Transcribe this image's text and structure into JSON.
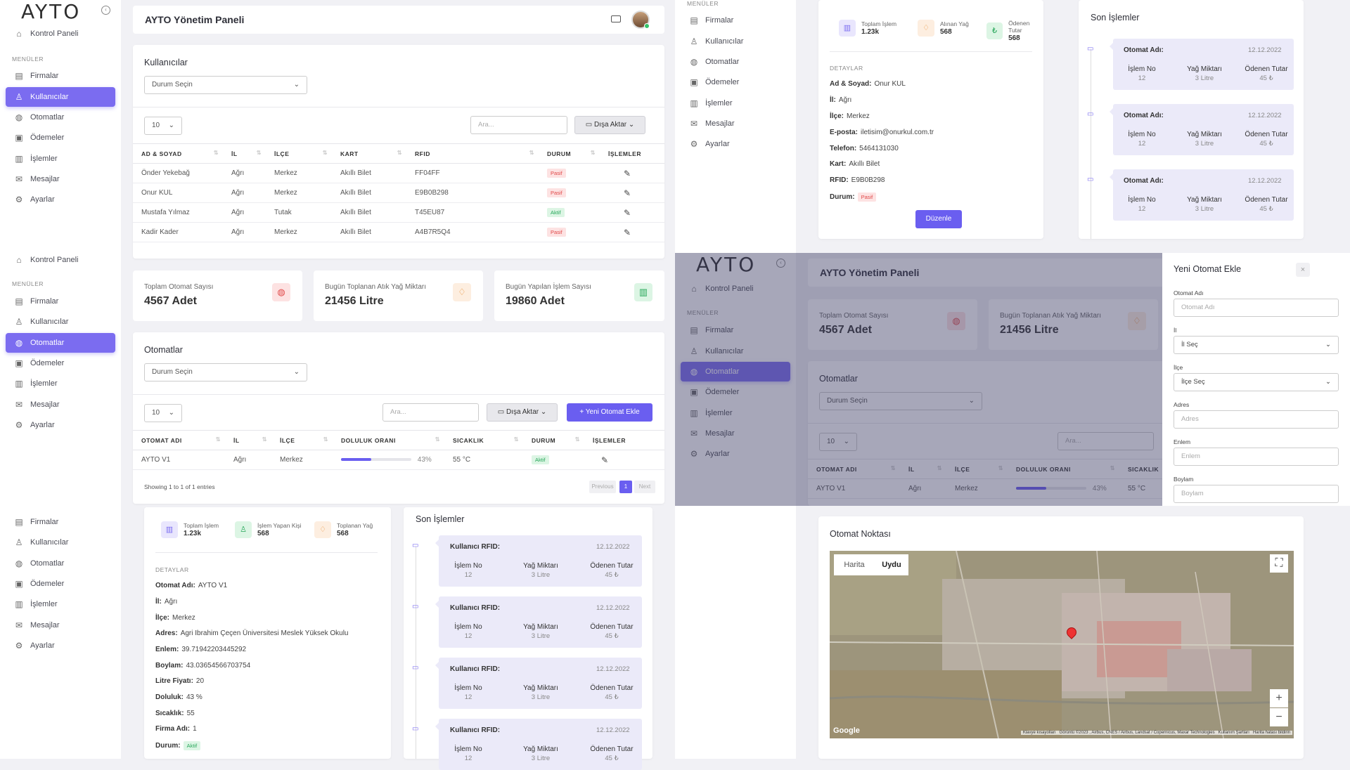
{
  "brand": {
    "logo": "AYTO",
    "app_title": "AYTO Yönetim Paneli"
  },
  "sidebar": {
    "dashboard": "Kontrol Paneli",
    "section": "MENÜLER",
    "items": [
      "Firmalar",
      "Kullanıcılar",
      "Otomatlar",
      "Ödemeler",
      "İşlemler",
      "Mesajlar",
      "Ayarlar"
    ]
  },
  "users": {
    "title": "Kullanıcılar",
    "status_filter": "Durum Seçin",
    "page_size": "10",
    "search_placeholder": "Ara...",
    "export": "Dışa Aktar",
    "columns": [
      "AD & SOYAD",
      "İL",
      "İLÇE",
      "KART",
      "RFID",
      "DURUM",
      "İŞLEMLER"
    ],
    "rows": [
      {
        "name": "Önder Yekebağ",
        "il": "Ağrı",
        "ilce": "Merkez",
        "kart": "Akıllı Bilet",
        "rfid": "FF04FF",
        "durum": "Pasif"
      },
      {
        "name": "Onur KUL",
        "il": "Ağrı",
        "ilce": "Merkez",
        "kart": "Akıllı Bilet",
        "rfid": "E9B0B298",
        "durum": "Pasif"
      },
      {
        "name": "Mustafa Yılmaz",
        "il": "Ağrı",
        "ilce": "Tutak",
        "kart": "Akıllı Bilet",
        "rfid": "T45EU87",
        "durum": "Aktif"
      },
      {
        "name": "Kadir Kader",
        "il": "Ağrı",
        "ilce": "Merkez",
        "kart": "Akıllı Bilet",
        "rfid": "A4B7R5Q4",
        "durum": "Pasif"
      }
    ]
  },
  "stats": [
    {
      "label": "Toplam Otomat Sayısı",
      "value": "4567 Adet"
    },
    {
      "label": "Bugün Toplanan Atık Yağ Miktarı",
      "value": "21456 Litre"
    },
    {
      "label": "Bugün Yapılan İşlem Sayısı",
      "value": "19860 Adet"
    }
  ],
  "machines": {
    "title": "Otomatlar",
    "status_filter": "Durum Seçin",
    "page_size": "10",
    "search_placeholder": "Ara...",
    "export": "Dışa Aktar",
    "add": "Yeni Otomat Ekle",
    "columns": [
      "OTOMAT ADI",
      "İL",
      "İLÇE",
      "DOLULUK ORANI",
      "SICAKLIK",
      "DURUM",
      "İŞLEMLER"
    ],
    "rows": [
      {
        "name": "AYTO V1",
        "il": "Ağrı",
        "ilce": "Merkez",
        "doluluk": 43,
        "doluluk_text": "43%",
        "sicaklik": "55 °C",
        "durum": "Aktif"
      }
    ],
    "showing": "Showing 1 to 1 of 1 entries",
    "prev": "Previous",
    "page": "1",
    "next": "Next"
  },
  "machine_detail": {
    "mini": [
      {
        "label": "Toplam İşlem",
        "value": "1.23k"
      },
      {
        "label": "İşlem Yapan Kişi",
        "value": "568"
      },
      {
        "label": "Toplanan Yağ",
        "value": "568"
      }
    ],
    "heading": "DETAYLAR",
    "fields": [
      {
        "k": "Otomat Adı:",
        "v": "AYTO V1"
      },
      {
        "k": "İl:",
        "v": "Ağrı"
      },
      {
        "k": "İlçe:",
        "v": "Merkez"
      },
      {
        "k": "Adres:",
        "v": "Agri Ibrahim Çeçen Üniversitesi Meslek Yüksek Okulu"
      },
      {
        "k": "Enlem:",
        "v": "39.71942203445292"
      },
      {
        "k": "Boylam:",
        "v": "43.03654566703754"
      },
      {
        "k": "Litre Fiyatı:",
        "v": "20"
      },
      {
        "k": "Doluluk:",
        "v": "43 %"
      },
      {
        "k": "Sıcaklık:",
        "v": "55"
      },
      {
        "k": "Firma Adı:",
        "v": "1"
      },
      {
        "k": "Durum:",
        "v": "Aktif"
      }
    ]
  },
  "recent_machine": {
    "title": "Son İşlemler",
    "items": [
      {
        "title": "Kullanıcı RFID:",
        "date": "12.12.2022",
        "islem_label": "İşlem No",
        "islem": "12",
        "yag_label": "Yağ Miktarı",
        "yag": "3 Litre",
        "tutar_label": "Ödenen Tutar",
        "tutar": "45 ₺"
      },
      {
        "title": "Kullanıcı RFID:",
        "date": "12.12.2022",
        "islem_label": "İşlem No",
        "islem": "12",
        "yag_label": "Yağ Miktarı",
        "yag": "3 Litre",
        "tutar_label": "Ödenen Tutar",
        "tutar": "45 ₺"
      },
      {
        "title": "Kullanıcı RFID:",
        "date": "12.12.2022",
        "islem_label": "İşlem No",
        "islem": "12",
        "yag_label": "Yağ Miktarı",
        "yag": "3 Litre",
        "tutar_label": "Ödenen Tutar",
        "tutar": "45 ₺"
      },
      {
        "title": "Kullanıcı RFID:",
        "date": "12.12.2022",
        "islem_label": "İşlem No",
        "islem": "12",
        "yag_label": "Yağ Miktarı",
        "yag": "3 Litre",
        "tutar_label": "Ödenen Tutar",
        "tutar": "45 ₺"
      }
    ]
  },
  "user_detail": {
    "mini": [
      {
        "label": "Toplam İşlem",
        "value": "1.23k"
      },
      {
        "label": "Alınan Yağ",
        "value": "568"
      },
      {
        "label": "Ödenen Tutar",
        "value": "568"
      }
    ],
    "heading": "DETAYLAR",
    "fields": [
      {
        "k": "Ad & Soyad:",
        "v": "Onur KUL"
      },
      {
        "k": "İl:",
        "v": "Ağrı"
      },
      {
        "k": "İlçe:",
        "v": "Merkez"
      },
      {
        "k": "E-posta:",
        "v": "iletisim@onurkul.com.tr"
      },
      {
        "k": "Telefon:",
        "v": "5464131030"
      },
      {
        "k": "Kart:",
        "v": "Akıllı Bilet"
      },
      {
        "k": "RFID:",
        "v": "E9B0B298"
      },
      {
        "k": "Durum:",
        "v": "Pasif"
      }
    ],
    "edit": "Düzenle"
  },
  "recent_user": {
    "title": "Son İşlemler",
    "items": [
      {
        "title": "Otomat Adı:",
        "date": "12.12.2022",
        "islem_label": "İşlem No",
        "islem": "12",
        "yag_label": "Yağ Miktarı",
        "yag": "3 Litre",
        "tutar_label": "Ödenen Tutar",
        "tutar": "45 ₺"
      },
      {
        "title": "Otomat Adı:",
        "date": "12.12.2022",
        "islem_label": "İşlem No",
        "islem": "12",
        "yag_label": "Yağ Miktarı",
        "yag": "3 Litre",
        "tutar_label": "Ödenen Tutar",
        "tutar": "45 ₺"
      },
      {
        "title": "Otomat Adı:",
        "date": "12.12.2022",
        "islem_label": "İşlem No",
        "islem": "12",
        "yag_label": "Yağ Miktarı",
        "yag": "3 Litre",
        "tutar_label": "Ödenen Tutar",
        "tutar": "45 ₺"
      }
    ]
  },
  "modal": {
    "title": "Yeni Otomat Ekle",
    "name_label": "Otomat Adı",
    "name_ph": "Otomat Adı",
    "il_label": "İl",
    "il_value": "İl Seç",
    "ilce_label": "İlçe",
    "ilce_value": "İlçe Seç",
    "adres_label": "Adres",
    "adres_ph": "Adres",
    "enlem_label": "Enlem",
    "enlem_ph": "Enlem",
    "boylam_label": "Boylam",
    "boylam_ph": "Boylam"
  },
  "map": {
    "title": "Otomat Noktası",
    "tab_map": "Harita",
    "tab_sat": "Uydu",
    "zoom_in": "+",
    "zoom_out": "−",
    "brand": "Google",
    "attribution": "Klavye kısayolları   Görüntü ©2023 , Airbus, CNES / Airbus, Landsat / Copernicus, Maxar Technologies   Kullanım Şartları   Harita hatası bildirin"
  },
  "colors": {
    "accent": "#6a5ef0",
    "aktif": "#27a75a",
    "pasif": "#e04a4a"
  }
}
